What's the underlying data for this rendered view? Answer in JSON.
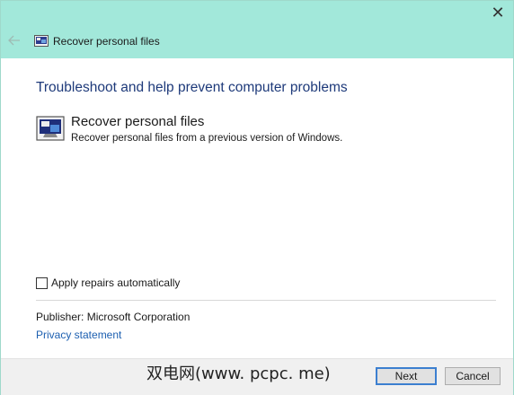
{
  "window": {
    "title": "Recover personal files"
  },
  "main": {
    "heading": "Troubleshoot and help prevent computer problems",
    "item": {
      "title": "Recover personal files",
      "description": "Recover personal files from a previous version of Windows."
    },
    "apply_repairs_label": "Apply repairs automatically",
    "apply_repairs_checked": false,
    "publisher": "Publisher:  Microsoft Corporation",
    "privacy_link": "Privacy statement"
  },
  "footer": {
    "watermark": "双电网(www. pcpc. me)",
    "next_label": "Next",
    "cancel_label": "Cancel"
  },
  "icons": {
    "close": "close-icon",
    "back": "back-arrow-icon",
    "title": "recover-files-icon",
    "item": "recover-files-icon"
  },
  "colors": {
    "titlebar": "#a2e8da",
    "heading": "#1e3a7a",
    "link": "#1c5fb0",
    "default_button_border": "#3c7fd0"
  }
}
